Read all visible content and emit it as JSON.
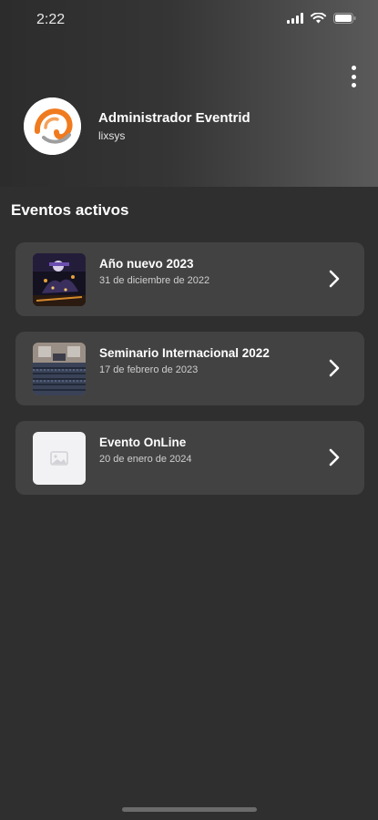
{
  "status_bar": {
    "time": "2:22",
    "icons": [
      "signal-icon",
      "wifi-icon",
      "battery-icon"
    ]
  },
  "header": {
    "menu_icon": "more-vertical-icon",
    "profile": {
      "name": "Administrador Eventrid",
      "organization": "lixsys",
      "avatar_icon": "eventrid-logo",
      "accent_color": "#f07a1e"
    }
  },
  "section": {
    "title": "Eventos activos"
  },
  "events": [
    {
      "title": "Año nuevo 2023",
      "date": "31 de diciembre de 2022",
      "thumb": "party-photo"
    },
    {
      "title": "Seminario Internacional 2022",
      "date": "17 de febrero de 2023",
      "thumb": "auditorium-photo"
    },
    {
      "title": "Evento OnLine",
      "date": "20 de enero de 2024",
      "thumb": "image-placeholder-icon"
    }
  ],
  "colors": {
    "background": "#2f2f2f",
    "card": "#424242",
    "text": "#ffffff",
    "secondary_text": "#cfcfcf"
  }
}
